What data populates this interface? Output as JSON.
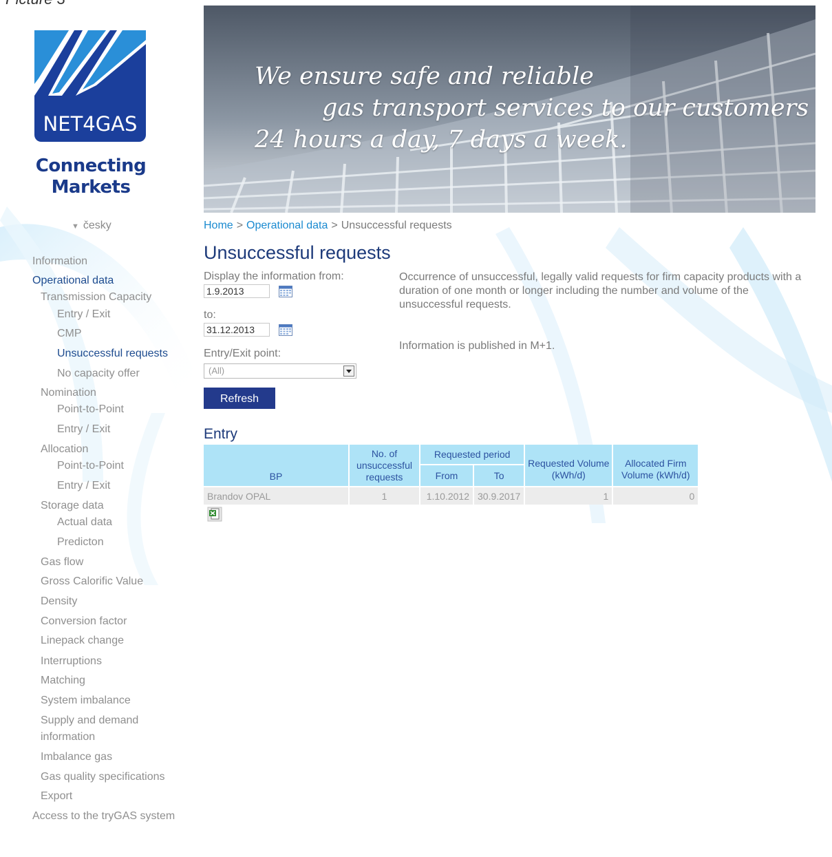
{
  "caption": "Picture 3",
  "logo": {
    "text": "NET4GAS"
  },
  "slogan": {
    "line1": "Connecting",
    "line2": "Markets"
  },
  "language": "česky",
  "nav": [
    {
      "label": "Information",
      "level": 0,
      "active": false
    },
    {
      "label": "Operational data",
      "level": 0,
      "active": true
    },
    {
      "label": "Transmission Capacity",
      "level": 1,
      "active": false
    },
    {
      "label": "Entry / Exit",
      "level": 2,
      "active": false
    },
    {
      "label": "CMP",
      "level": 2,
      "active": false
    },
    {
      "label": "Unsuccessful requests",
      "level": 2,
      "active": true
    },
    {
      "label": "No capacity offer",
      "level": 2,
      "active": false
    },
    {
      "label": "Nomination",
      "level": 1,
      "active": false
    },
    {
      "label": "Point-to-Point",
      "level": 2,
      "active": false
    },
    {
      "label": "Entry / Exit",
      "level": 2,
      "active": false
    },
    {
      "label": "Allocation",
      "level": 1,
      "active": false
    },
    {
      "label": "Point-to-Point",
      "level": 2,
      "active": false
    },
    {
      "label": "Entry / Exit",
      "level": 2,
      "active": false
    },
    {
      "label": "Storage data",
      "level": 1,
      "active": false
    },
    {
      "label": "Actual data",
      "level": 2,
      "active": false
    },
    {
      "label": "Predicton",
      "level": 2,
      "active": false
    },
    {
      "label": "Gas flow",
      "level": 1,
      "active": false
    },
    {
      "label": "Gross Calorific Value",
      "level": 1,
      "active": false
    },
    {
      "label": "Density",
      "level": 1,
      "active": false
    },
    {
      "label": "Conversion factor",
      "level": 1,
      "active": false
    },
    {
      "label": "Linepack change",
      "level": 1,
      "active": false
    },
    {
      "label": "Interruptions",
      "level": 1,
      "active": false
    },
    {
      "label": "Matching",
      "level": 1,
      "active": false
    },
    {
      "label": "System imbalance",
      "level": 1,
      "active": false
    },
    {
      "label": "Supply and demand",
      "level": 1,
      "active": false
    },
    {
      "label": "information",
      "level": 1,
      "active": false
    },
    {
      "label": "Imbalance gas",
      "level": 1,
      "active": false
    },
    {
      "label": "Gas quality specifications",
      "level": 1,
      "active": false
    },
    {
      "label": "Export",
      "level": 1,
      "active": false
    },
    {
      "label": "Access to the tryGAS system",
      "level": 0,
      "active": false
    }
  ],
  "banner": {
    "line1": "We ensure safe and reliable",
    "line2": "gas transport services to our customers",
    "line3": "24 hours a day, 7 days a week."
  },
  "breadcrumb": {
    "home": "Home",
    "sep": ">",
    "section": "Operational data",
    "current": "Unsuccessful requests"
  },
  "page_title": "Unsuccessful requests",
  "filters": {
    "from_label": "Display the information from:",
    "from_value": "1.9.2013",
    "to_label": "to:",
    "to_value": "31.12.2013",
    "point_label": "Entry/Exit point:",
    "point_value": "(All)",
    "refresh_label": "Refresh"
  },
  "description": "Occurrence of unsuccessful, legally valid requests for firm capacity products with a duration of one month or longer including the number and volume of the unsuccessful requests.",
  "published_note": "Information is published in M+1.",
  "entry_section": "Entry",
  "table": {
    "headers": {
      "bp": "BP",
      "count": "No. of unsuccessful requests",
      "period": "Requested period",
      "from": "From",
      "to": "To",
      "requested": "Requested Volume (kWh/d)",
      "allocated": "Allocated Firm Volume (kWh/d)"
    },
    "rows": [
      {
        "bp": "Brandov OPAL",
        "count": "1",
        "from": "1.10.2012",
        "to": "30.9.2017",
        "requested": "1",
        "allocated": "0"
      }
    ]
  },
  "colors": {
    "accent": "#1d3a7a",
    "link": "#1a8ad0",
    "header_bg": "#aee3f7",
    "button": "#233a8c"
  }
}
